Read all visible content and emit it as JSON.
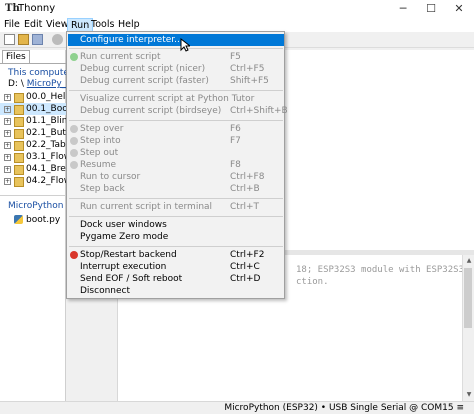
{
  "window": {
    "title": "Thonny",
    "app_icon": "Th",
    "controls": {
      "minimize": "─",
      "maximize": "☐",
      "close": "✕"
    }
  },
  "menubar": {
    "items": [
      "File",
      "Edit",
      "View",
      "Run",
      "Tools",
      "Help"
    ],
    "active": "Run"
  },
  "files": {
    "tab_label": "Files",
    "computer_title": "This computer",
    "computer_path_drive": "D:",
    "computer_path_folder": "MicroPy_Co",
    "items": [
      "00.0_HelloW",
      "00.1_Boot",
      "01.1_Blink",
      "02.1_Button",
      "02.2_TableL",
      "03.1_Flowin",
      "04.1_Breath",
      "04.2_Flowin"
    ],
    "selected": "00.1_Boot",
    "device_title": "MicroPython dev",
    "device_items": [
      "boot.py"
    ]
  },
  "run_menu": {
    "items": [
      {
        "label": "Configure interpreter...",
        "shortcut": "",
        "state": "highlighted"
      },
      {
        "label": "Run current script",
        "shortcut": "F5",
        "state": "disabled",
        "icon": "run-icon"
      },
      {
        "label": "Debug current script (nicer)",
        "shortcut": "Ctrl+F5",
        "state": "disabled"
      },
      {
        "label": "Debug current script (faster)",
        "shortcut": "Shift+F5",
        "state": "disabled"
      },
      {
        "label": "Visualize current script at Python Tutor",
        "shortcut": "",
        "state": "disabled"
      },
      {
        "label": "Debug current script (birdseye)",
        "shortcut": "Ctrl+Shift+B",
        "state": "disabled"
      },
      {
        "label": "Step over",
        "shortcut": "F6",
        "state": "disabled",
        "icon": "step-over-icon"
      },
      {
        "label": "Step into",
        "shortcut": "F7",
        "state": "disabled",
        "icon": "step-into-icon"
      },
      {
        "label": "Step out",
        "shortcut": "",
        "state": "disabled",
        "icon": "step-out-icon"
      },
      {
        "label": "Resume",
        "shortcut": "F8",
        "state": "disabled",
        "icon": "resume-icon"
      },
      {
        "label": "Run to cursor",
        "shortcut": "Ctrl+F8",
        "state": "disabled"
      },
      {
        "label": "Step back",
        "shortcut": "Ctrl+B",
        "state": "disabled"
      },
      {
        "label": "Run current script in terminal",
        "shortcut": "Ctrl+T",
        "state": "disabled"
      },
      {
        "label": "Dock user windows",
        "shortcut": "",
        "state": "enabled"
      },
      {
        "label": "Pygame Zero mode",
        "shortcut": "",
        "state": "enabled"
      },
      {
        "label": "Stop/Restart backend",
        "shortcut": "Ctrl+F2",
        "state": "enabled",
        "icon": "stop-icon"
      },
      {
        "label": "Interrupt execution",
        "shortcut": "Ctrl+C",
        "state": "enabled"
      },
      {
        "label": "Send EOF / Soft reboot",
        "shortcut": "Ctrl+D",
        "state": "enabled"
      },
      {
        "label": "Disconnect",
        "shortcut": "",
        "state": "enabled"
      }
    ]
  },
  "shell": {
    "line1": "18; ESP32S3 module with ESP32S3",
    "line2": "ction."
  },
  "statusbar": {
    "text": "MicroPython (ESP32)  •  USB Single Serial @ COM15  ≡"
  },
  "colors": {
    "highlight": "#0078d7",
    "disabled_text": "#8a8a8a",
    "link": "#1a4fa3"
  }
}
